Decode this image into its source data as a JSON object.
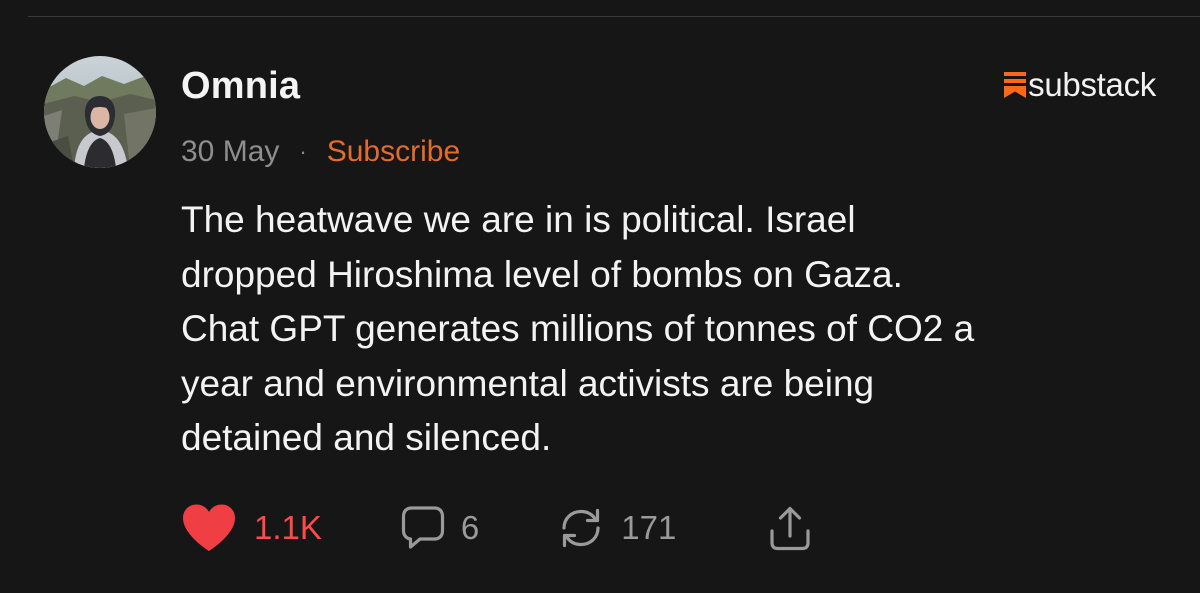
{
  "post": {
    "author": "Omnia",
    "date": "30 May",
    "separator": "·",
    "subscribe_label": "Subscribe",
    "body_lines": [
      "The heatwave we are in is political. Israel",
      "dropped Hiroshima level of bombs on Gaza.",
      "Chat GPT generates millions of tonnes of CO2 a",
      "year and environmental activists are being",
      "detained and silenced."
    ]
  },
  "brand": {
    "name": "substack",
    "icon": "substack-logo-icon",
    "color": "#ff6719"
  },
  "actions": {
    "like": {
      "icon": "heart-icon",
      "count": "1.1K",
      "color": "#ef3f45"
    },
    "comment": {
      "icon": "comment-icon",
      "count": "6"
    },
    "restack": {
      "icon": "restack-icon",
      "count": "171"
    },
    "share": {
      "icon": "share-icon"
    }
  },
  "colors": {
    "background": "#161616",
    "text": "#f3f3f3",
    "muted": "#8e8e8e",
    "accent": "#e46a2e"
  }
}
